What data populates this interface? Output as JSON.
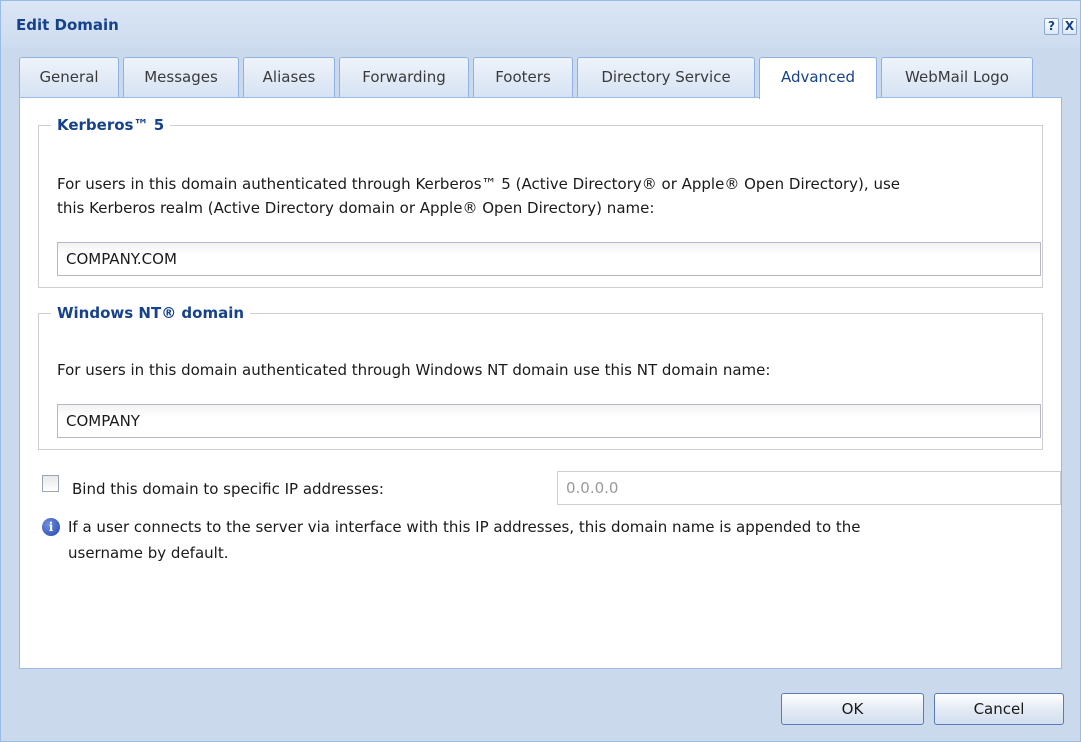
{
  "dialog": {
    "title": "Edit Domain",
    "help_label": "?",
    "close_label": "X"
  },
  "tabs": [
    {
      "label": "General"
    },
    {
      "label": "Messages"
    },
    {
      "label": "Aliases"
    },
    {
      "label": "Forwarding"
    },
    {
      "label": "Footers"
    },
    {
      "label": "Directory Service"
    },
    {
      "label": "Advanced",
      "active": true
    },
    {
      "label": "WebMail Logo"
    }
  ],
  "kerberos": {
    "legend": "Kerberos™ 5",
    "description_line1": "For users in this domain authenticated through Kerberos™ 5 (Active Directory® or Apple® Open Directory), use",
    "description_line2": "this Kerberos realm (Active Directory domain or Apple® Open Directory) name:",
    "realm_value": "COMPANY.COM"
  },
  "windows_nt": {
    "legend": "Windows NT® domain",
    "description": "For users in this domain authenticated through Windows NT domain use this NT domain name:",
    "domain_value": "COMPANY"
  },
  "bind_ip": {
    "checked": false,
    "label": "Bind this domain to specific IP addresses:",
    "ip_value": "0.0.0.0",
    "info_line1": "If a user connects to the server via interface with this IP addresses, this domain name is appended to the",
    "info_line2": "username by default."
  },
  "buttons": {
    "ok": "OK",
    "cancel": "Cancel"
  },
  "colors": {
    "title": "#15428b",
    "frame": "#cad9ec",
    "border": "#99bbe8"
  }
}
